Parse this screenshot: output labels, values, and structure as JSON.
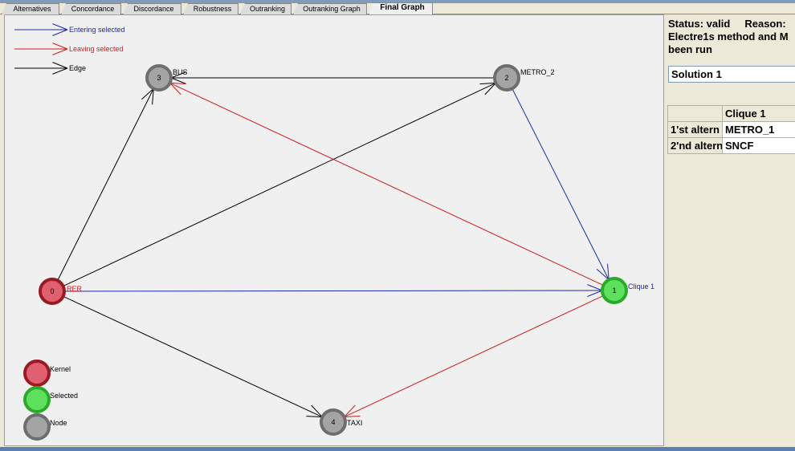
{
  "tabs": [
    {
      "label": "Alternatives",
      "active": false
    },
    {
      "label": "Concordance",
      "active": false
    },
    {
      "label": "Discordance",
      "active": false
    },
    {
      "label": "Robustness",
      "active": false
    },
    {
      "label": "Outranking",
      "active": false
    },
    {
      "label": "Outranking Graph",
      "active": false
    },
    {
      "label": "Final Graph",
      "active": true
    }
  ],
  "legend": {
    "entering": "Entering selected",
    "leaving": "Leaving selected",
    "edge": "Edge",
    "kernel": "Kernel",
    "selected": "Selected",
    "node": "Node"
  },
  "colors": {
    "entering": "#1c2aa8",
    "leaving": "#d11b1b",
    "edge": "#000000",
    "kernel_fill": "#e06070",
    "kernel_ring": "#9a1a24",
    "selected_fill": "#5ee05e",
    "selected_ring": "#2aaa2a",
    "node_fill": "#a4a4a4",
    "node_ring": "#6e6e6e"
  },
  "graph": {
    "nodes": [
      {
        "id": "0",
        "label": "RER",
        "kind": "kernel"
      },
      {
        "id": "1",
        "label": "Clique 1",
        "kind": "selected"
      },
      {
        "id": "2",
        "label": "METRO_2",
        "kind": "node"
      },
      {
        "id": "3",
        "label": "BUS",
        "kind": "node"
      },
      {
        "id": "4",
        "label": "TAXI",
        "kind": "node"
      }
    ],
    "edges": [
      {
        "from": "0",
        "to": "3",
        "type": "edge"
      },
      {
        "from": "0",
        "to": "2",
        "type": "edge"
      },
      {
        "from": "0",
        "to": "4",
        "type": "edge"
      },
      {
        "from": "2",
        "to": "3",
        "type": "edge"
      },
      {
        "from": "0",
        "to": "1",
        "type": "entering"
      },
      {
        "from": "2",
        "to": "1",
        "type": "entering"
      },
      {
        "from": "1",
        "to": "3",
        "type": "leaving"
      },
      {
        "from": "1",
        "to": "4",
        "type": "leaving"
      }
    ]
  },
  "side": {
    "status": "Status: valid     Reason:\nElectre1s method and M\nbeen run",
    "solution": "Solution 1",
    "table": {
      "header": "Clique 1",
      "rows": [
        {
          "label": "1'st altern",
          "value": "METRO_1"
        },
        {
          "label": "2'nd altern",
          "value": "SNCF"
        }
      ]
    }
  }
}
